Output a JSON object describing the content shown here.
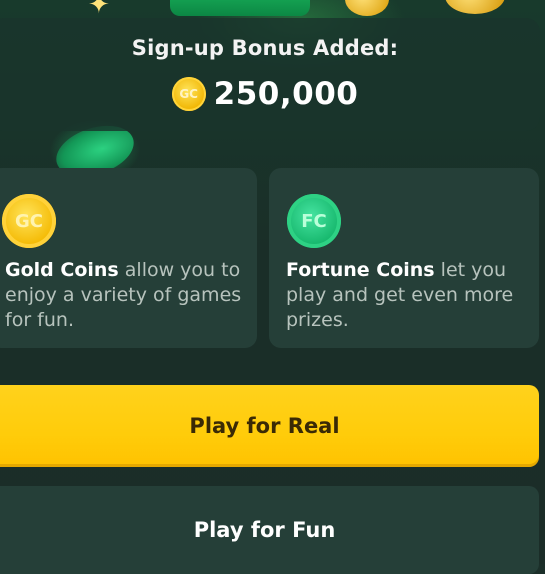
{
  "bonus": {
    "title": "Sign-up Bonus Added:",
    "coin_icon_text": "GC",
    "amount": "250,000"
  },
  "cards": {
    "gold": {
      "badge": "GC",
      "strong": "Gold Coins",
      "rest": "allow you to enjoy a variety of games for fun."
    },
    "fortune": {
      "badge": "FC",
      "strong": "Fortune Coins",
      "rest": "let you play and get even more prizes."
    }
  },
  "buttons": {
    "real": "Play for Real",
    "fun": "Play for Fun"
  },
  "colors": {
    "background": "#1b2f29",
    "panel": "#253f38",
    "accent_yellow": "#ffcc0a",
    "gold_coin": "#f4b800",
    "fortune_coin": "#14b56a"
  },
  "icons": [
    "gc-coin-icon",
    "fc-coin-icon",
    "sparkle-icon"
  ]
}
